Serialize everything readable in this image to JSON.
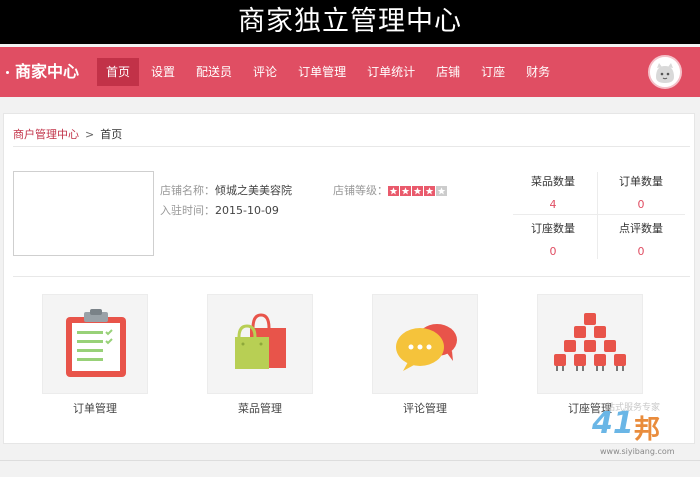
{
  "banner": {
    "title": "商家独立管理中心"
  },
  "topbar": {
    "brand": "商家中心",
    "nav": [
      {
        "label": "首页",
        "active": true
      },
      {
        "label": "设置"
      },
      {
        "label": "配送员"
      },
      {
        "label": "评论"
      },
      {
        "label": "订单管理"
      },
      {
        "label": "订单统计"
      },
      {
        "label": "店铺"
      },
      {
        "label": "订座"
      },
      {
        "label": "财务"
      }
    ],
    "avatar_icon": "user-avatar-icon"
  },
  "breadcrumb": {
    "root": "商户管理中心",
    "separator": ">",
    "current": "首页"
  },
  "store": {
    "name_label": "店铺名称：",
    "name_value": "倾城之美美容院",
    "join_label": "入驻时间：",
    "join_value": "2015-10-09",
    "level_label": "店铺等级：",
    "level_stars": 4,
    "level_max": 5
  },
  "stats": [
    {
      "label": "菜品数量",
      "value": "4"
    },
    {
      "label": "订单数量",
      "value": "0"
    },
    {
      "label": "订座数量",
      "value": "0"
    },
    {
      "label": "点评数量",
      "value": "0"
    }
  ],
  "tiles": [
    {
      "label": "订单管理",
      "icon": "clipboard-icon"
    },
    {
      "label": "菜品管理",
      "icon": "shopping-bags-icon"
    },
    {
      "label": "评论管理",
      "icon": "chat-bubbles-icon"
    },
    {
      "label": "订座管理",
      "icon": "seats-icon"
    }
  ],
  "watermark": {
    "tagline": "站式服务专家",
    "brand_num": "41",
    "brand_char": "邦",
    "url": "www.siyibang.com"
  },
  "colors": {
    "accent": "#e04e63",
    "accent_dark": "#c23248"
  }
}
